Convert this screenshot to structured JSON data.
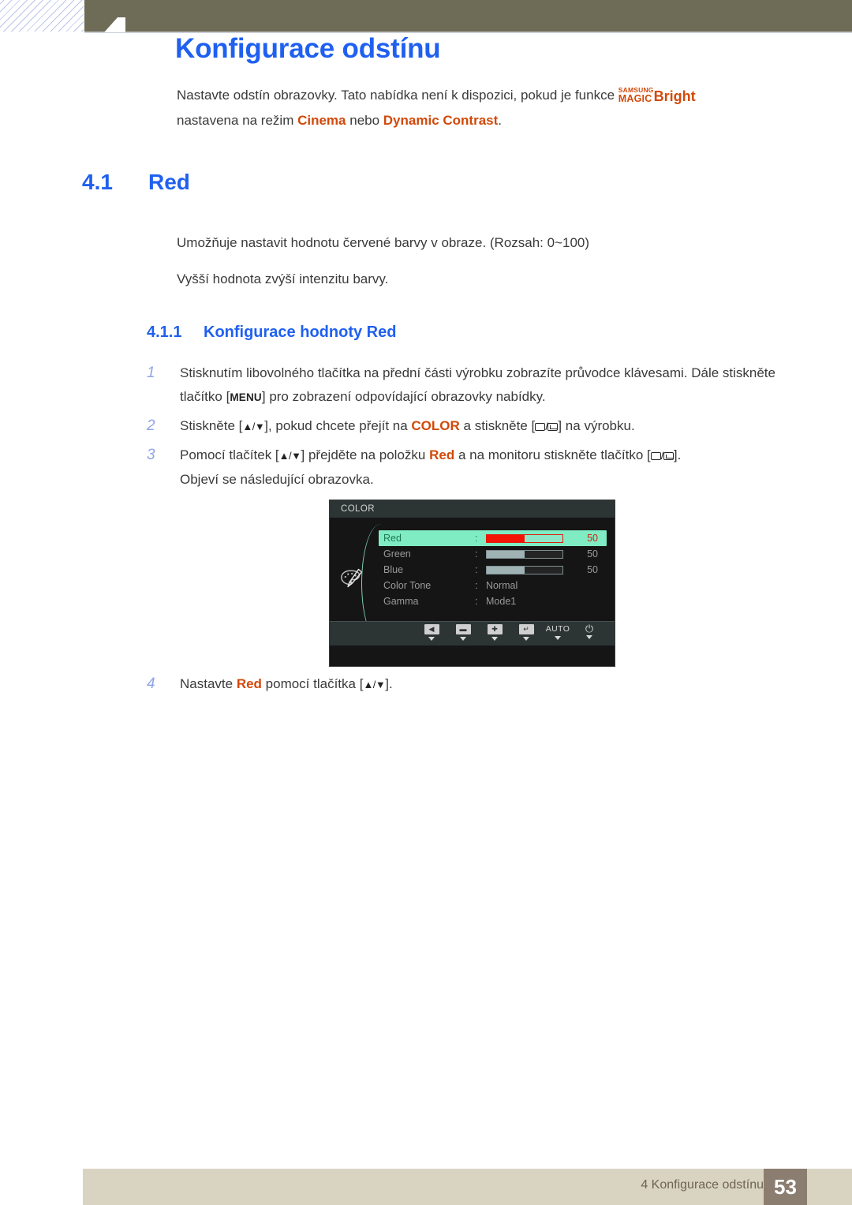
{
  "header": {
    "chapter_number": "4",
    "page_title": "Konfigurace odstínu"
  },
  "intro": {
    "text_before": "Nastavte odstín obrazovky. Tato nabídka není k dispozici, pokud je funkce ",
    "logo_samsung": "SAMSUNG",
    "logo_magic": "MAGIC",
    "logo_bright": "Bright",
    "text_line2_a": "nastavena na režim ",
    "accent_cinema": "Cinema",
    "text_line2_b": " nebo ",
    "accent_dynamic": "Dynamic Contrast",
    "text_line2_c": "."
  },
  "section": {
    "number": "4.1",
    "title": "Red",
    "paragraph_1": "Umožňuje nastavit hodnotu červené barvy v obraze. (Rozsah: 0~100)",
    "paragraph_2": "Vyšší hodnota zvýší intenzitu barvy."
  },
  "subsection": {
    "number": "4.1.1",
    "title": "Konfigurace hodnoty Red"
  },
  "steps": [
    {
      "index": "1",
      "part_a": "Stisknutím libovolného tlačítka na přední části výrobku zobrazíte průvodce klávesami. Dále stiskněte tlačítko [",
      "keycap": "MENU",
      "part_b": "] pro zobrazení odpovídající obrazovky nabídky."
    },
    {
      "index": "2",
      "part_a": "Stiskněte [",
      "arrows": "▲/▼",
      "part_b": "], pokud chcete přejít na ",
      "accent": "COLOR",
      "part_c": " a stiskněte [",
      "part_d": "] na výrobku."
    },
    {
      "index": "3",
      "part_a": "Pomocí tlačítek [",
      "arrows": "▲/▼",
      "part_b": "] přejděte na položku ",
      "accent": "Red",
      "part_c": " a na monitoru stiskněte tlačítko [",
      "part_d": "].",
      "sub": "Objeví se následující obrazovka."
    },
    {
      "index": "4",
      "part_a": "Nastavte ",
      "accent": "Red",
      "part_b": " pomocí tlačítka [",
      "arrows": "▲/▼",
      "part_c": "]."
    }
  ],
  "osd": {
    "title": "COLOR",
    "rows": [
      {
        "label": "Red",
        "colon": ":",
        "type": "slider",
        "value": "50",
        "fill_percent": 50,
        "selected": true
      },
      {
        "label": "Green",
        "colon": ":",
        "type": "slider",
        "value": "50",
        "fill_percent": 50,
        "selected": false
      },
      {
        "label": "Blue",
        "colon": ":",
        "type": "slider",
        "value": "50",
        "fill_percent": 50,
        "selected": false
      },
      {
        "label": "Color Tone",
        "colon": ":",
        "type": "text",
        "value": "Normal",
        "selected": false
      },
      {
        "label": "Gamma",
        "colon": ":",
        "type": "text",
        "value": "Mode1",
        "selected": false
      }
    ],
    "footer_buttons": [
      {
        "name": "left-arrow-button",
        "glyph": "◀",
        "style": "cap"
      },
      {
        "name": "minus-button",
        "glyph": "▬",
        "style": "cap"
      },
      {
        "name": "plus-button",
        "glyph": "✚",
        "style": "cap"
      },
      {
        "name": "enter-button",
        "glyph": "↵",
        "style": "cap"
      },
      {
        "name": "auto-button",
        "glyph": "AUTO",
        "style": "text"
      },
      {
        "name": "power-button",
        "glyph": "⏻",
        "style": "plain"
      }
    ],
    "colors": {
      "selected_row_bg": "#7fecc4",
      "selected_fill": "#f41404",
      "selected_value": "#d8200e",
      "slider_fill": "#9fb2b4",
      "panel_bg": "#151515",
      "titlebar_bg": "#2c3434"
    }
  },
  "footer": {
    "chapter_label": "4 Konfigurace odstínu",
    "page_number": "53"
  },
  "theme": {
    "heading_blue": "#2060f0",
    "accent_orange": "#d2490a",
    "header_olive": "#6e6b57",
    "footer_tan": "#d9d4c2",
    "footer_page_box": "#8b7d70"
  }
}
